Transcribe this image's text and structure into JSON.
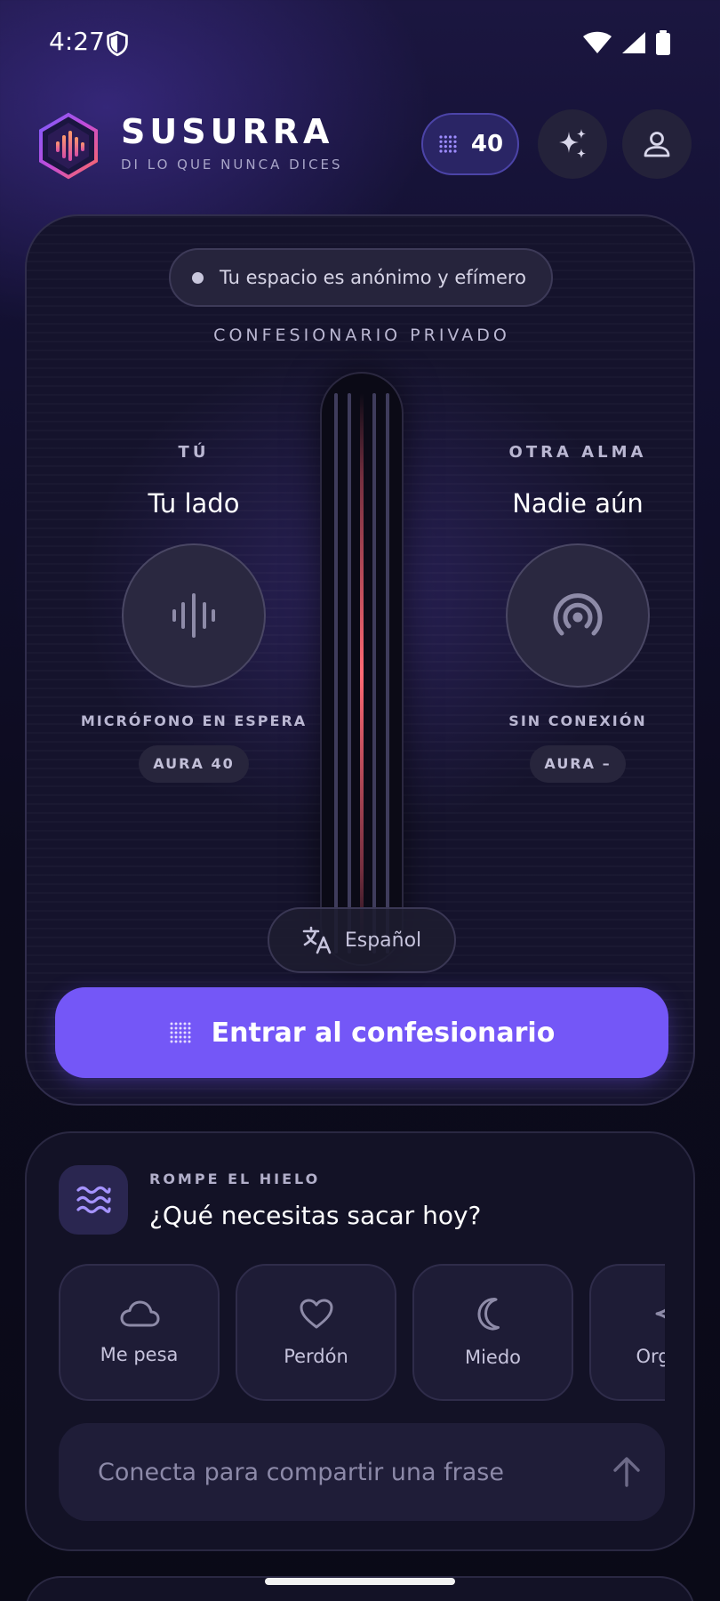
{
  "status_bar": {
    "time": "4:27",
    "icons": [
      "shield-icon",
      "wifi-icon",
      "signal-icon",
      "battery-icon"
    ]
  },
  "header": {
    "brand": "SUSURRA",
    "tagline": "DI LO QUE NUNCA DICES",
    "credits": "40",
    "actions": [
      "sparkles-icon",
      "profile-icon"
    ]
  },
  "confessional": {
    "privacy_note": "Tu espacio es anónimo y efímero",
    "section_label": "CONFESIONARIO PRIVADO",
    "you": {
      "label": "TÚ",
      "name": "Tu lado",
      "status": "MICRÓFONO EN ESPERA",
      "aura": "AURA 40",
      "icon": "waveform-icon"
    },
    "other": {
      "label": "OTRA ALMA",
      "name": "Nadie aún",
      "status": "SIN CONEXIÓN",
      "aura": "AURA –",
      "icon": "broadcast-icon"
    },
    "language": "Español",
    "enter_button": "Entrar al confesionario"
  },
  "icebreaker": {
    "eyebrow": "ROMPE EL HIELO",
    "title": "¿Qué necesitas sacar hoy?",
    "chips": [
      {
        "label": "Me pesa",
        "icon": "cloud-icon"
      },
      {
        "label": "Perdón",
        "icon": "heart-icon"
      },
      {
        "label": "Miedo",
        "icon": "moon-icon"
      },
      {
        "label": "Orgullo",
        "icon": "sparkle-icon"
      }
    ],
    "input_placeholder": "Conecta para compartir una frase"
  },
  "colors": {
    "accent": "#7457f7",
    "background": "#0c0b1d",
    "card": "#15132c",
    "slot_glow": "#e0556a"
  }
}
